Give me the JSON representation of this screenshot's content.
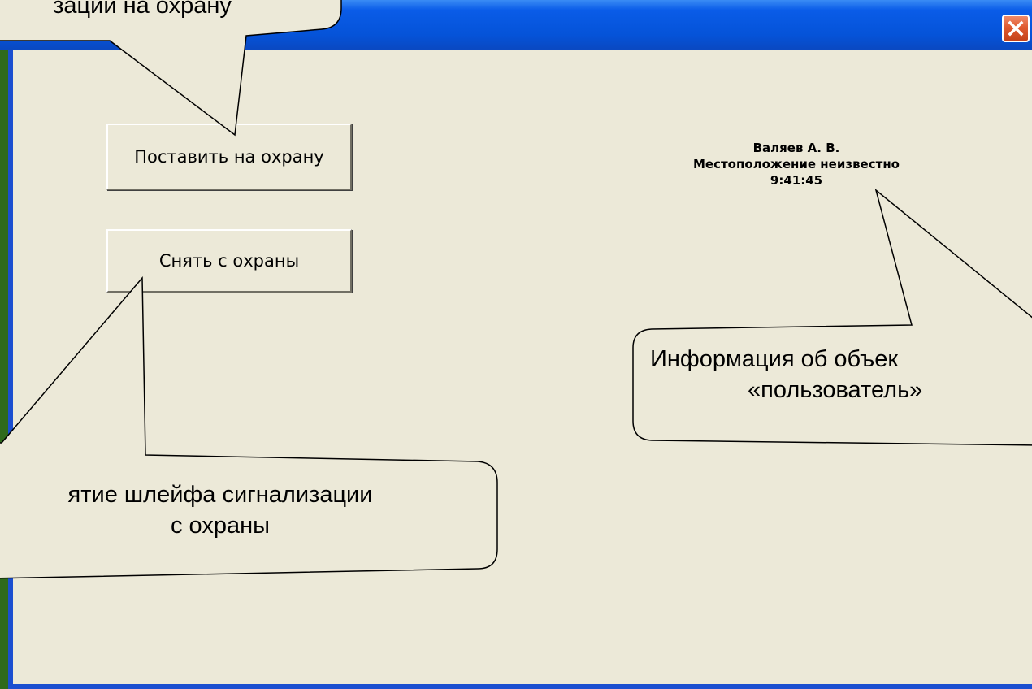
{
  "window": {
    "close_button": "close-icon"
  },
  "buttons": {
    "arm_label": "Поставить на охрану",
    "disarm_label": "Снять с охраны"
  },
  "user_info": {
    "name": "Валяев А. В.",
    "location": "Местоположение неизвестно",
    "time": "9:41:45"
  },
  "callouts": {
    "top": "зации на охрану",
    "bottom_line1": "ятие шлейфа сигнализации",
    "bottom_line2": "с охраны",
    "right_line1": "Информация об объек",
    "right_line2": "«пользователь»"
  },
  "colors": {
    "background": "#2f6a1c",
    "title_bar": "#0553d8",
    "client": "#ece9d8",
    "close": "#e05a30",
    "callout_fill": "#ece9d8"
  }
}
